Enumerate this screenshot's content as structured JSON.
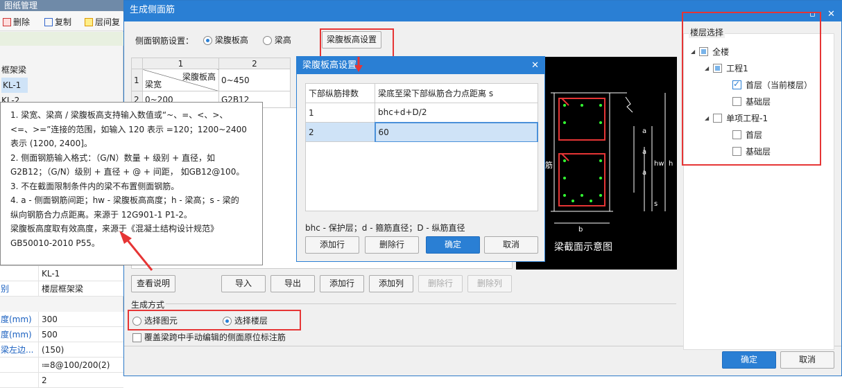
{
  "left": {
    "title": "图纸管理",
    "toolbar": [
      "删除",
      "复制",
      "层间复"
    ],
    "tree": [
      "框架梁",
      "KL-1",
      "KL-2"
    ],
    "props": [
      [
        "",
        "KL-1"
      ],
      [
        "别",
        "楼层框架梁"
      ],
      [
        "度(mm)",
        "300"
      ],
      [
        "度(mm)",
        "500"
      ],
      [
        "梁左边...",
        "(150)"
      ],
      [
        "",
        "≔8@100/200(2)"
      ],
      [
        "",
        "2"
      ]
    ]
  },
  "dialog": {
    "title": "生成侧面筋",
    "side_label": "侧面钢筋设置：",
    "opt1": "梁腹板高",
    "opt2": "梁高",
    "setbtn": "梁腹板高设置",
    "table": {
      "col1": "1",
      "col2": "2",
      "r1": "1",
      "r2": "2",
      "hdr_top": "梁腹板高",
      "hdr_bot": "梁宽",
      "c1": "0~450",
      "c2": "0~200",
      "c3": "G2B12"
    },
    "tip_lines": [
      "1. 梁宽、梁高 / 梁腹板高支持输入数值或“~、=、<、>、",
      "<=、>=”连接的范围，如输入 120 表示 =120；1200~2400",
      "表示 (1200, 2400]。",
      "2. 侧面钢筋输入格式：（G/N）数量 + 级别 + 直径，如",
      "G2B12；（G/N）级别 + 直径 + @ + 间距， 如GB12@100。",
      "3. 不在截面限制条件内的梁不布置侧面钢筋。",
      "4. a - 侧面钢筋间距；hw - 梁腹板高高度；h - 梁高；s - 梁的",
      "纵向钢筋合力点距离。来源于 12G901-1 P1-2。",
      "梁腹板高度取有效高度，来源于《混凝土结构设计规范》",
      "GB50010-2010 P55。"
    ],
    "btns": [
      "查看说明",
      "导入",
      "导出",
      "添加行",
      "添加列",
      "删除行",
      "删除列"
    ],
    "gen_label": "生成方式",
    "gen1": "选择图元",
    "gen2": "选择楼层",
    "cover": "覆盖梁跨中手动编辑的侧面原位标注筋",
    "ok": "确定",
    "cancel": "取消",
    "diagram_title": "梁截面示意图",
    "dim": {
      "a": "a",
      "hw": "hw",
      "h": "h",
      "s": "s",
      "b": "b",
      "jin": "筋"
    }
  },
  "sub": {
    "title": "梁腹板高设置",
    "h1": "下部纵筋排数",
    "h2": "梁底至梁下部纵筋合力点距离 s",
    "rows": [
      [
        "1",
        "bhc+d+D/2"
      ],
      [
        "2",
        "60"
      ]
    ],
    "legend": "bhc - 保护层；d - 箍筋直径；D - 纵筋直径",
    "add": "添加行",
    "del": "删除行",
    "ok": "确定",
    "cancel": "取消"
  },
  "floors": {
    "title": "楼层选择",
    "all": "全楼",
    "proj1": "工程1",
    "f1": "首层（当前楼层）",
    "base1": "基础层",
    "proj2": "单项工程-1",
    "f2": "首层",
    "base2": "基础层"
  }
}
